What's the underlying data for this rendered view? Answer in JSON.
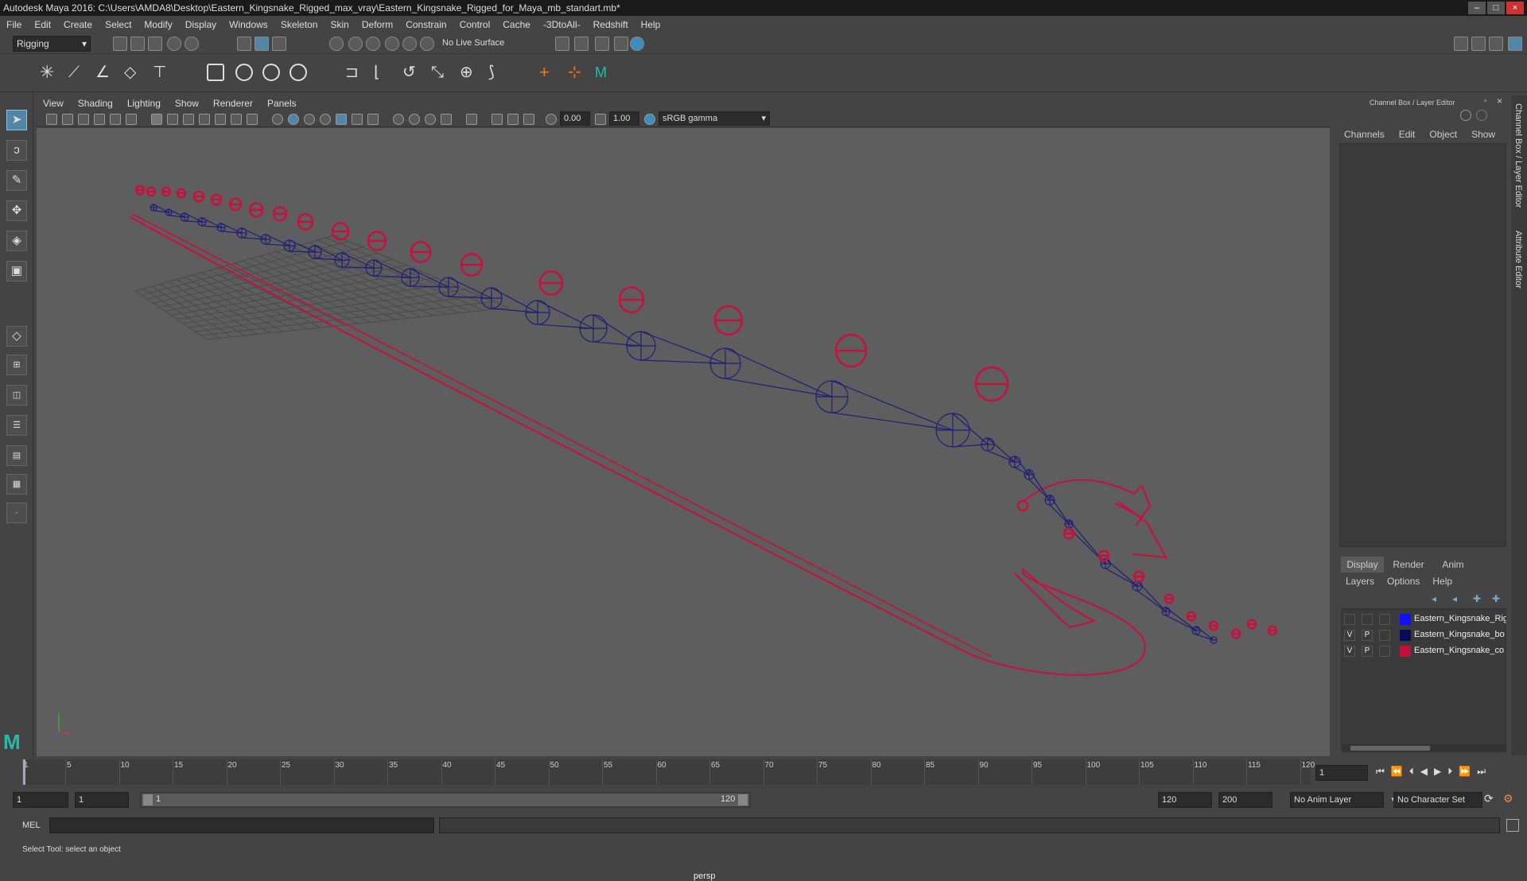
{
  "title_bar": {
    "text": "Autodesk Maya 2016: C:\\Users\\AMDA8\\Desktop\\Eastern_Kingsnake_Rigged_max_vray\\Eastern_Kingsnake_Rigged_for_Maya_mb_standart.mb*"
  },
  "menubar": [
    "File",
    "Edit",
    "Create",
    "Select",
    "Modify",
    "Display",
    "Windows",
    "Skeleton",
    "Skin",
    "Deform",
    "Constrain",
    "Control",
    "Cache",
    "-3DtoAll-",
    "Redshift",
    "Help"
  ],
  "status_line": {
    "menu_set": "Rigging",
    "live_surface": "No Live Surface"
  },
  "panel_menu": [
    "View",
    "Shading",
    "Lighting",
    "Show",
    "Renderer",
    "Panels"
  ],
  "panel_toolbar": {
    "exposure": "0.00",
    "gamma": "1.00",
    "color_space": "sRGB gamma"
  },
  "viewport": {
    "camera_label": "persp"
  },
  "channel_box": {
    "title": "Channel Box / Layer Editor",
    "menu": [
      "Channels",
      "Edit",
      "Object",
      "Show"
    ],
    "side_tabs": [
      "Channel Box / Layer Editor",
      "Attribute Editor"
    ]
  },
  "layer_editor": {
    "tabs": [
      "Display",
      "Render",
      "Anim"
    ],
    "active_tab": "Display",
    "menu": [
      "Layers",
      "Options",
      "Help"
    ],
    "layers": [
      {
        "v": "",
        "p": "",
        "color": "#1010ff",
        "name": "Eastern_Kingsnake_Rig"
      },
      {
        "v": "V",
        "p": "P",
        "color": "#0a0a5a",
        "name": "Eastern_Kingsnake_bo"
      },
      {
        "v": "V",
        "p": "P",
        "color": "#c0103a",
        "name": "Eastern_Kingsnake_co"
      }
    ]
  },
  "time_slider": {
    "ticks": [
      "1",
      "5",
      "10",
      "15",
      "20",
      "25",
      "30",
      "35",
      "40",
      "45",
      "50",
      "55",
      "60",
      "65",
      "70",
      "75",
      "80",
      "85",
      "90",
      "95",
      "100",
      "105",
      "110",
      "115",
      "120"
    ],
    "current_frame": "1"
  },
  "range_slider": {
    "start": "1",
    "playback_start": "1",
    "range_start_label": "1",
    "range_end_label": "120",
    "playback_end": "120",
    "end": "200",
    "anim_layer": "No Anim Layer",
    "character_set": "No Character Set"
  },
  "command_line": {
    "label": "MEL"
  },
  "help_line": {
    "text": "Select Tool: select an object"
  },
  "colors": {
    "controls": "#c8103c",
    "joints": "#1e1e78",
    "selection": "#5285a6"
  }
}
